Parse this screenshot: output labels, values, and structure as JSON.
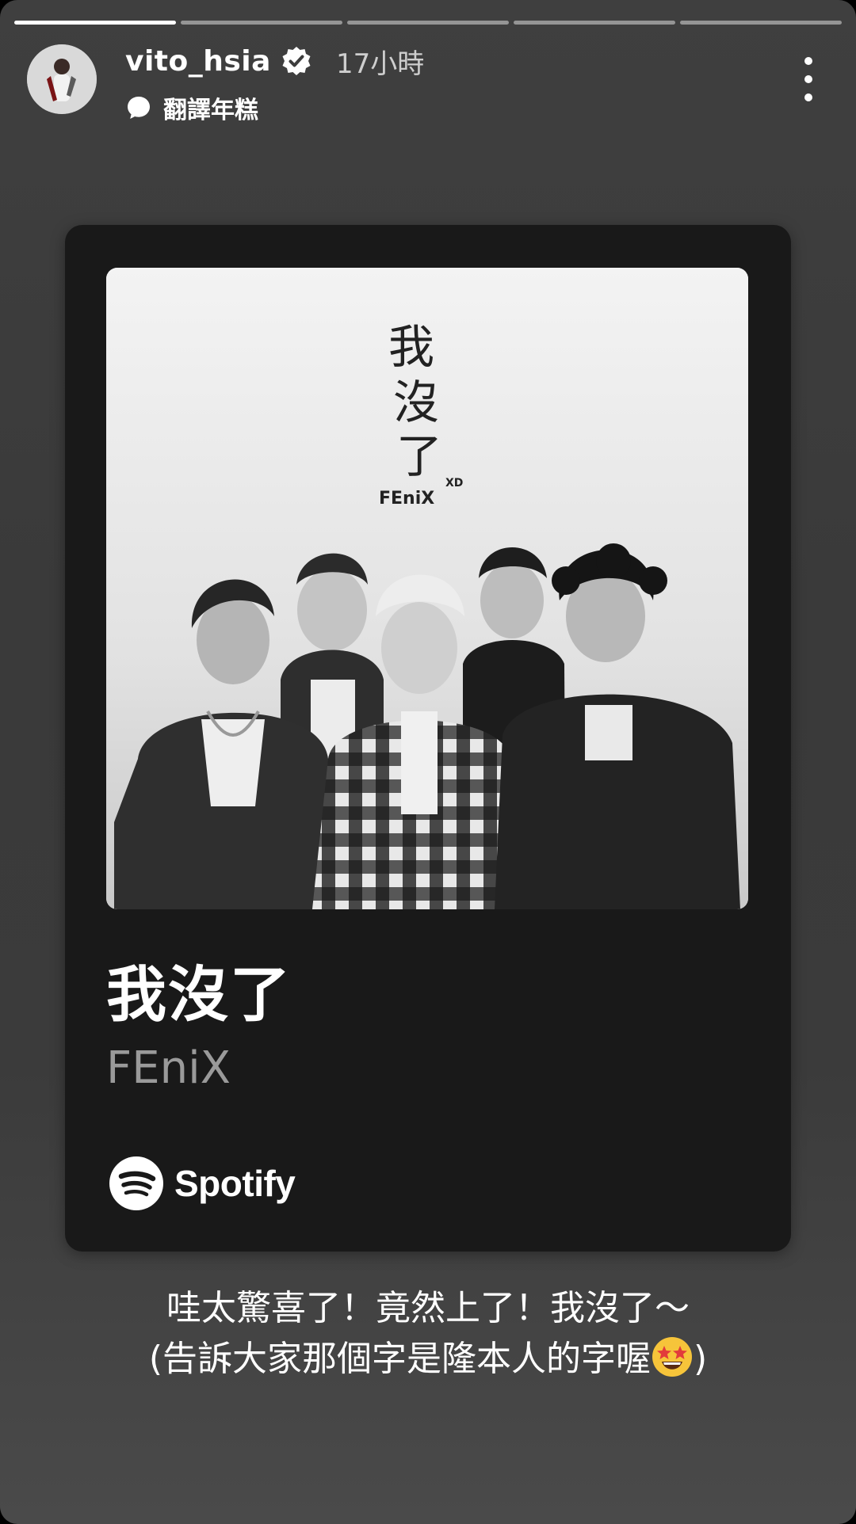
{
  "story": {
    "progress_count": 5,
    "active_segment": 1
  },
  "header": {
    "username": "vito_hsia",
    "time_ago": "17小時",
    "translate_label": "翻譯年糕"
  },
  "card": {
    "track_title": "我沒了",
    "artist": "FEniX",
    "service": "Spotify",
    "cover_handwriting": {
      "line1": "我",
      "line2": "沒",
      "line3": "了",
      "signature": "FEniX",
      "xd": "XD"
    }
  },
  "caption": {
    "line1": "哇太驚喜了！竟然上了！我沒了～",
    "line2_open": "(告訴大家那個字是隆本人的字喔",
    "line2_close": ")"
  },
  "icons": [
    "verified-icon",
    "speech-bubble-icon",
    "more-options-icon",
    "spotify-icon",
    "star-struck-emoji-icon"
  ],
  "colors": {
    "background": "#3d3d3d",
    "card": "#191919",
    "artist_text": "#9a9a9a",
    "progress_active": "#ffffff"
  }
}
